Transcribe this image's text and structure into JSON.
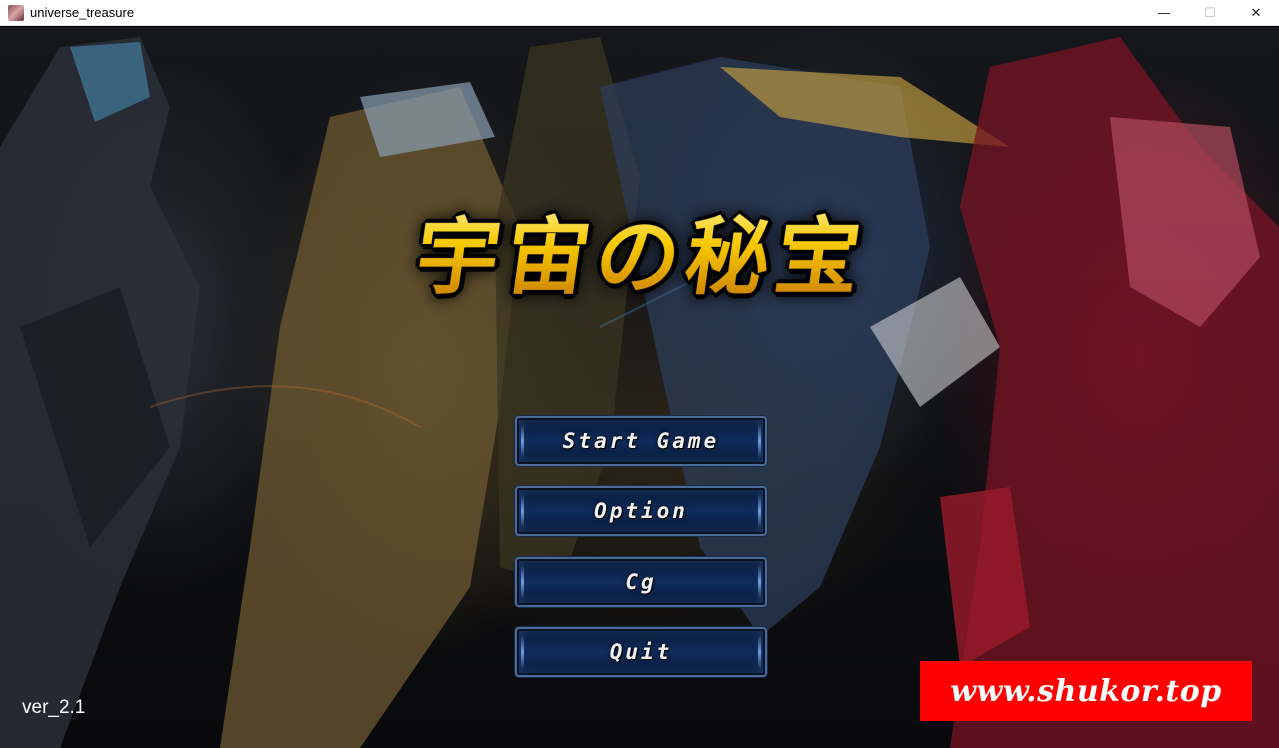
{
  "window": {
    "title": "universe_treasure",
    "minimize": "—",
    "maximize": "☐",
    "close": "✕"
  },
  "game": {
    "logo": "宇宙の秘宝",
    "menu": [
      {
        "label": "Start Game"
      },
      {
        "label": "Option"
      },
      {
        "label": "Cg"
      },
      {
        "label": "Quit"
      }
    ],
    "version": "ver_2.1",
    "watermark": "www.shukor.top"
  },
  "colors": {
    "logo_gold": "#f5c400",
    "button_border": "#4a6c9a",
    "button_fill": "#0f2c5c",
    "watermark_bg": "#ff0000"
  }
}
